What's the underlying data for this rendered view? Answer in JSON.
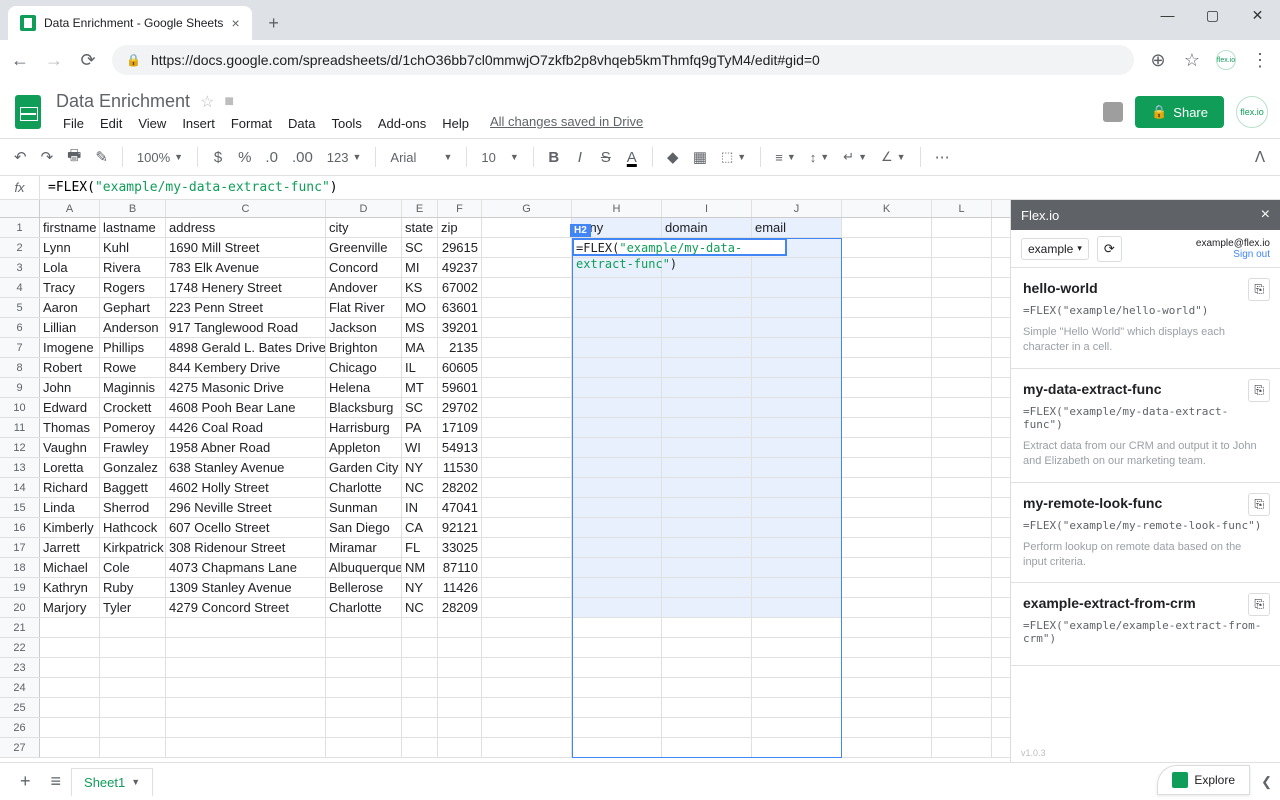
{
  "browser": {
    "tab_title": "Data Enrichment - Google Sheets",
    "url": "https://docs.google.com/spreadsheets/d/1chO36bb7cl0mmwjO7zkfb2p8vhqeb5kmThmfq9gTyM4/edit#gid=0"
  },
  "doc": {
    "title": "Data Enrichment",
    "saved_msg": "All changes saved in Drive",
    "menus": [
      "File",
      "Edit",
      "View",
      "Insert",
      "Format",
      "Data",
      "Tools",
      "Add-ons",
      "Help"
    ]
  },
  "share_label": "Share",
  "toolbar": {
    "zoom": "100%",
    "font": "Arial",
    "font_size": "10",
    "number_format": "123"
  },
  "formula": {
    "prefix": "=FLEX(",
    "arg": "\"example/my-data-extract-func\"",
    "suffix": ")"
  },
  "active_cell": "H2",
  "columns": [
    "A",
    "B",
    "C",
    "D",
    "E",
    "F",
    "G",
    "H",
    "I",
    "J",
    "K",
    "L"
  ],
  "headers": [
    "firstname",
    "lastname",
    "address",
    "city",
    "state",
    "zip",
    "",
    "pany",
    "domain",
    "email"
  ],
  "rows": [
    [
      "Lynn",
      "Kuhl",
      "1690 Mill Street",
      "Greenville",
      "SC",
      "29615"
    ],
    [
      "Lola",
      "Rivera",
      "783 Elk Avenue",
      "Concord",
      "MI",
      "49237"
    ],
    [
      "Tracy",
      "Rogers",
      "1748 Henery Street",
      "Andover",
      "KS",
      "67002"
    ],
    [
      "Aaron",
      "Gephart",
      "223 Penn Street",
      "Flat River",
      "MO",
      "63601"
    ],
    [
      "Lillian",
      "Anderson",
      "917 Tanglewood Road",
      "Jackson",
      "MS",
      "39201"
    ],
    [
      "Imogene",
      "Phillips",
      "4898 Gerald L. Bates Drive",
      "Brighton",
      "MA",
      "2135"
    ],
    [
      "Robert",
      "Rowe",
      "844 Kembery Drive",
      "Chicago",
      "IL",
      "60605"
    ],
    [
      "John",
      "Maginnis",
      "4275 Masonic Drive",
      "Helena",
      "MT",
      "59601"
    ],
    [
      "Edward",
      "Crockett",
      "4608 Pooh Bear Lane",
      "Blacksburg",
      "SC",
      "29702"
    ],
    [
      "Thomas",
      "Pomeroy",
      "4426 Coal Road",
      "Harrisburg",
      "PA",
      "17109"
    ],
    [
      "Vaughn",
      "Frawley",
      "1958 Abner Road",
      "Appleton",
      "WI",
      "54913"
    ],
    [
      "Loretta",
      "Gonzalez",
      "638 Stanley Avenue",
      "Garden City",
      "NY",
      "11530"
    ],
    [
      "Richard",
      "Baggett",
      "4602 Holly Street",
      "Charlotte",
      "NC",
      "28202"
    ],
    [
      "Linda",
      "Sherrod",
      "296 Neville Street",
      "Sunman",
      "IN",
      "47041"
    ],
    [
      "Kimberly",
      "Hathcock",
      "607 Ocello Street",
      "San Diego",
      "CA",
      "92121"
    ],
    [
      "Jarrett",
      "Kirkpatrick",
      "308 Ridenour Street",
      "Miramar",
      "FL",
      "33025"
    ],
    [
      "Michael",
      "Cole",
      "4073 Chapmans Lane",
      "Albuquerque",
      "NM",
      "87110"
    ],
    [
      "Kathryn",
      "Ruby",
      "1309 Stanley Avenue",
      "Bellerose",
      "NY",
      "11426"
    ],
    [
      "Marjory",
      "Tyler",
      "4279 Concord Street",
      "Charlotte",
      "NC",
      "28209"
    ]
  ],
  "empty_rows": 7,
  "sheet_tab": "Sheet1",
  "explore_label": "Explore",
  "panel": {
    "title": "Flex.io",
    "dropdown": "example",
    "user_email": "example@flex.io",
    "signout": "Sign out",
    "version": "v1.0.3",
    "items": [
      {
        "title": "hello-world",
        "code": "=FLEX(\"example/hello-world\")",
        "desc": "Simple \"Hello World\" which displays each character in a cell."
      },
      {
        "title": "my-data-extract-func",
        "code": "=FLEX(\"example/my-data-extract-func\")",
        "desc": "Extract data from our CRM and output it to John and Elizabeth on our marketing team."
      },
      {
        "title": "my-remote-look-func",
        "code": "=FLEX(\"example/my-remote-look-func\")",
        "desc": "Perform lookup on remote data based on the input criteria."
      },
      {
        "title": "example-extract-from-crm",
        "code": "=FLEX(\"example/example-extract-from-crm\")",
        "desc": ""
      }
    ]
  }
}
